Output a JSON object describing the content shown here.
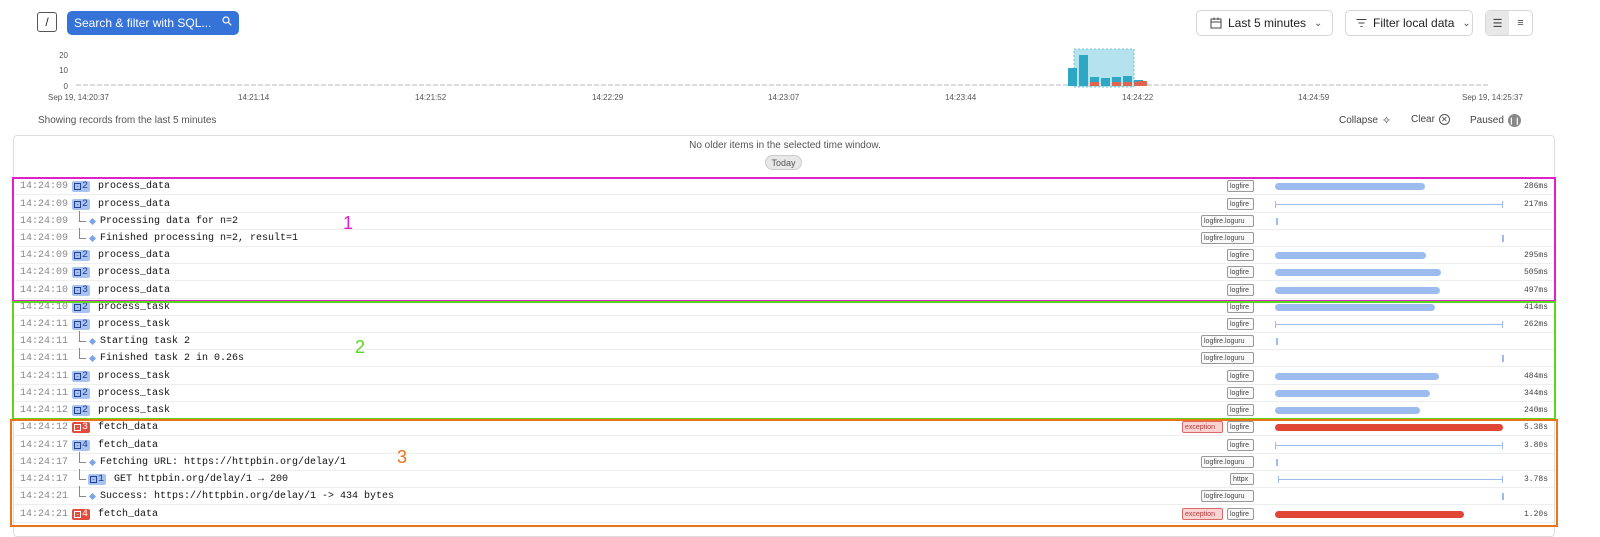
{
  "search": {
    "slash": "/",
    "placeholder": "Search & filter with SQL..."
  },
  "time_range": {
    "label": "Last 5 minutes"
  },
  "filter": {
    "label": "Filter local data"
  },
  "histogram": {
    "yticks": [
      "20",
      "10",
      "0"
    ],
    "xticks": [
      "Sep 19, 14:20:37",
      "14:21:14",
      "14:21:52",
      "14:22:29",
      "14:23:07",
      "14:23:44",
      "14:24:22",
      "14:24:59",
      "Sep 19, 14:25:37"
    ],
    "colors": {
      "ok": "#2ea7c4",
      "error": "#e0654e",
      "selection": "#b4e3ee"
    }
  },
  "status_text": "Showing records from the last 5 minutes",
  "controls": {
    "collapse": "Collapse",
    "clear": "Clear",
    "paused": "Paused"
  },
  "timeline": {
    "no_older": "No older items in the selected time window.",
    "today": "Today"
  },
  "rows": [
    {
      "ts": "14:24:09",
      "count": "2",
      "name": "process_data",
      "tags": [
        "logfire"
      ],
      "duration": "286ms"
    },
    {
      "ts": "14:24:09",
      "count": "2",
      "name": "process_data",
      "tags": [
        "logfire"
      ],
      "duration": "217ms"
    },
    {
      "ts": "14:24:09",
      "name": "Processing data for n=2",
      "tags": [
        "logfire.loguru"
      ]
    },
    {
      "ts": "14:24:09",
      "name": "Finished processing n=2, result=1",
      "tags": [
        "logfire.loguru"
      ]
    },
    {
      "ts": "14:24:09",
      "count": "2",
      "name": "process_data",
      "tags": [
        "logfire"
      ],
      "duration": "295ms"
    },
    {
      "ts": "14:24:09",
      "count": "2",
      "name": "process_data",
      "tags": [
        "logfire"
      ],
      "duration": "505ms"
    },
    {
      "ts": "14:24:10",
      "count": "3",
      "name": "process_data",
      "tags": [
        "logfire"
      ],
      "duration": "497ms"
    },
    {
      "ts": "14:24:10",
      "count": "2",
      "name": "process_task",
      "tags": [
        "logfire"
      ],
      "duration": "414ms"
    },
    {
      "ts": "14:24:11",
      "count": "2",
      "name": "process_task",
      "tags": [
        "logfire"
      ],
      "duration": "262ms"
    },
    {
      "ts": "14:24:11",
      "name": "Starting task 2",
      "tags": [
        "logfire.loguru"
      ]
    },
    {
      "ts": "14:24:11",
      "name": "Finished task 2 in 0.26s",
      "tags": [
        "logfire.loguru"
      ]
    },
    {
      "ts": "14:24:11",
      "count": "2",
      "name": "process_task",
      "tags": [
        "logfire"
      ],
      "duration": "484ms"
    },
    {
      "ts": "14:24:11",
      "count": "2",
      "name": "process_task",
      "tags": [
        "logfire"
      ],
      "duration": "344ms"
    },
    {
      "ts": "14:24:12",
      "count": "2",
      "name": "process_task",
      "tags": [
        "logfire"
      ],
      "duration": "240ms"
    },
    {
      "ts": "14:24:12",
      "count": "3",
      "name": "fetch_data",
      "tags": [
        "exception",
        "logfire"
      ],
      "duration": "5.38s"
    },
    {
      "ts": "14:24:17",
      "count": "4",
      "name": "fetch_data",
      "tags": [
        "logfire"
      ],
      "duration": "3.80s"
    },
    {
      "ts": "14:24:17",
      "name": "Fetching URL: https://httpbin.org/delay/1",
      "tags": [
        "logfire.loguru"
      ]
    },
    {
      "ts": "14:24:17",
      "count": "1",
      "name": "GET httpbin.org/delay/1 → 200",
      "tags": [
        "httpx"
      ],
      "duration": "3.78s"
    },
    {
      "ts": "14:24:21",
      "name": "Success: https://httpbin.org/delay/1 -> 434 bytes",
      "tags": [
        "logfire.loguru"
      ]
    },
    {
      "ts": "14:24:21",
      "count": "4",
      "name": "fetch_data",
      "tags": [
        "exception",
        "logfire"
      ],
      "duration": "1.20s"
    }
  ],
  "annotations": [
    {
      "label": "1",
      "color": "#e020c8"
    },
    {
      "label": "2",
      "color": "#5ad61e"
    },
    {
      "label": "3",
      "color": "#ea7417"
    }
  ]
}
